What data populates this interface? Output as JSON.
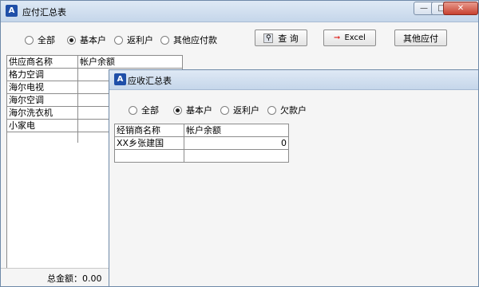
{
  "payable": {
    "title": "应付汇总表",
    "app_icon": "A",
    "controls": {
      "minimize": "—",
      "restore": "□",
      "close": "✕"
    },
    "radios": [
      {
        "label": "全部",
        "checked": false
      },
      {
        "label": "基本户",
        "checked": true
      },
      {
        "label": "返利户",
        "checked": false
      },
      {
        "label": "其他应付款",
        "checked": false
      }
    ],
    "query_button": "查 询",
    "excel_button": "Excel",
    "other_payable_button": "其他应付",
    "columns": [
      "供应商名称",
      "帐户余额"
    ],
    "rows": [
      [
        "格力空调",
        ""
      ],
      [
        "海尔电视",
        ""
      ],
      [
        "海尔空调",
        ""
      ],
      [
        "海尔洗衣机",
        ""
      ],
      [
        "小家电",
        ""
      ],
      [
        "",
        ""
      ]
    ],
    "total": "总金额：0.00"
  },
  "receivable": {
    "title": "应收汇总表",
    "app_icon": "A",
    "radios": [
      {
        "label": "全部",
        "checked": false
      },
      {
        "label": "基本户",
        "checked": true
      },
      {
        "label": "返利户",
        "checked": false
      },
      {
        "label": "欠款户",
        "checked": false
      }
    ],
    "columns": [
      "经销商名称",
      "帐户余额"
    ],
    "rows": [
      [
        "XX乡张建国",
        "0"
      ],
      [
        "",
        ""
      ]
    ]
  },
  "colors": {
    "excel_arrow": "#e0201c",
    "title_gradient_top": "#dfe9f5",
    "title_gradient_bottom": "#c5d6ea"
  }
}
